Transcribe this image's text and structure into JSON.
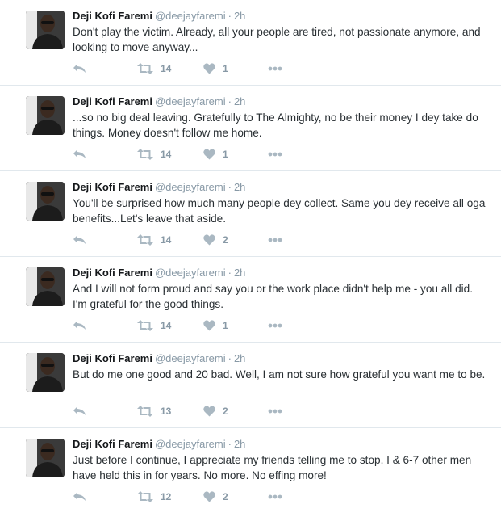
{
  "tweets": [
    {
      "name": "Deji Kofi Faremi",
      "handle": "@deejayfaremi",
      "separator": "·",
      "time": "2h",
      "text": "Don't play the victim. Already, all your people are tired, not passionate anymore, and looking to move anyway...",
      "retweets": "14",
      "likes": "1"
    },
    {
      "name": "Deji Kofi Faremi",
      "handle": "@deejayfaremi",
      "separator": "·",
      "time": "2h",
      "text": "...so no big deal leaving. Gratefully to The Almighty, no be their money I dey take do things. Money doesn't follow me home.",
      "retweets": "14",
      "likes": "1"
    },
    {
      "name": "Deji Kofi Faremi",
      "handle": "@deejayfaremi",
      "separator": "·",
      "time": "2h",
      "text": "You'll be surprised how much many people dey collect. Same you dey receive all oga benefits...Let's leave that aside.",
      "retweets": "14",
      "likes": "2"
    },
    {
      "name": "Deji Kofi Faremi",
      "handle": "@deejayfaremi",
      "separator": "·",
      "time": "2h",
      "text": "And I will not form proud and say you or the work place didn't help me - you all did. I'm grateful for the good things.",
      "retweets": "14",
      "likes": "1"
    },
    {
      "name": "Deji Kofi Faremi",
      "handle": "@deejayfaremi",
      "separator": "·",
      "time": "2h",
      "text": "But do me one good and 20 bad. Well, I am not sure how grateful you want me to be.",
      "retweets": "13",
      "likes": "2"
    },
    {
      "name": "Deji Kofi Faremi",
      "handle": "@deejayfaremi",
      "separator": "·",
      "time": "2h",
      "text": "Just before I continue, I appreciate my friends telling me to stop. I & 6-7 other men have held this in for years. No more. No effing more!",
      "retweets": "12",
      "likes": "2"
    }
  ],
  "icons": {
    "reply": "reply-icon",
    "retweet": "retweet-icon",
    "like": "heart-icon",
    "more": "more-icon"
  },
  "colors": {
    "icon": "#aab8c2",
    "secondary_text": "#8899a6",
    "divider": "#e1e8ed"
  }
}
